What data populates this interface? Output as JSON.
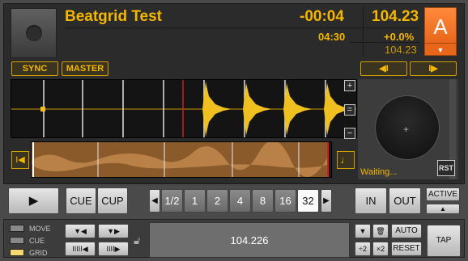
{
  "track": {
    "title": "Beatgrid Test",
    "remaining": "-00:04",
    "elapsed": "04:30",
    "bpm": "104.23",
    "pitch": "+0.0%",
    "bpm_secondary": "104.23"
  },
  "deck": {
    "letter": "A",
    "menu_icon": "triangle-down-icon"
  },
  "buttons": {
    "sync": "SYNC",
    "master": "MASTER",
    "beatjump_back": "◀I",
    "beatjump_forward": "I▶"
  },
  "side_buttons": {
    "plus": "+",
    "equal": "=",
    "minus": "−"
  },
  "status": {
    "waiting": "Waiting...",
    "rst": "RST"
  },
  "transport": {
    "play_icon": "▶",
    "cue": "CUE",
    "cup": "CUP"
  },
  "loop": {
    "sizes": [
      "1/2",
      "1",
      "2",
      "4",
      "8",
      "16",
      "32"
    ],
    "selected": "32"
  },
  "inout": {
    "in": "IN",
    "out": "OUT",
    "active": "ACTIVE"
  },
  "modes": {
    "move": "MOVE",
    "cue": "CUE",
    "grid": "GRID",
    "active": "GRID"
  },
  "bpm_display": "104.226",
  "grid_buttons": {
    "auto": "AUTO",
    "div2": "÷2",
    "mul2": "×2",
    "reset": "RESET",
    "tap": "TAP"
  },
  "colors": {
    "accent": "#f5b700",
    "deck": "#e8661a",
    "waveform": "#f0c020",
    "overview": "#8a5a2a"
  }
}
